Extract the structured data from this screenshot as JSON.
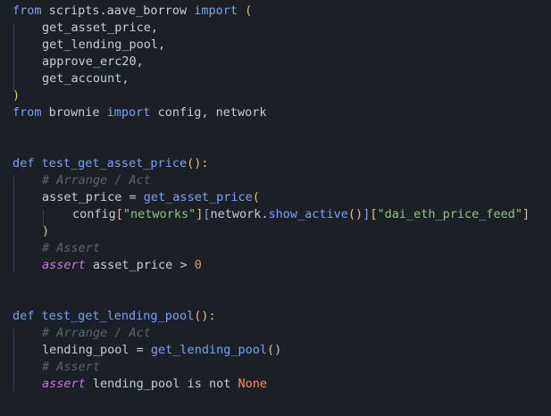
{
  "code": {
    "lines": [
      {
        "from1": "from",
        "mod1": " scripts.aave_borrow ",
        "imp1": "import",
        "open1": " ("
      },
      {
        "name": "get_asset_price,"
      },
      {
        "name": "get_lending_pool,"
      },
      {
        "name": "approve_erc20,"
      },
      {
        "name": "get_account,"
      },
      {
        "close": ")"
      },
      {
        "from2": "from",
        "mod2": " brownie ",
        "imp2": "import",
        "rest2": " config, network"
      },
      {},
      {},
      {
        "def": "def",
        "fname": " test_get_asset_price",
        "parens": "():",
        "colon": ""
      },
      {
        "comment": "# Arrange / Act"
      },
      {
        "lhs": "asset_price = ",
        "call": "get_asset_price",
        "paren": "("
      },
      {
        "cfg": "config",
        "b1o": "[",
        "s1": "\"networks\"",
        "b1c": "]",
        "b2o": "[",
        "net": "network.",
        "meth": "show_active",
        "mp": "()",
        "b2c": "]",
        "b3o": "[",
        "s2": "\"dai_eth_price_feed\"",
        "b3c": "]"
      },
      {
        "close": ")"
      },
      {
        "comment": "# Assert"
      },
      {
        "assert": "assert",
        "expr": " asset_price > ",
        "num": "0"
      },
      {},
      {},
      {
        "def": "def",
        "fname": " test_get_lending_pool",
        "parens": "():"
      },
      {
        "comment": "# Arrange / Act"
      },
      {
        "lhs": "lending_pool = ",
        "call": "get_lending_pool",
        "paren": "()"
      },
      {
        "comment": "# Assert"
      },
      {
        "assert": "assert",
        "expr": " lending_pool is not ",
        "none": "None"
      }
    ]
  },
  "colors": {
    "background": "#1c1f26",
    "keyword": "#7aa2f7",
    "function": "#7aa2f7",
    "paren": "#e5c07b",
    "string": "#98c379",
    "comment": "#5c6370",
    "assert": "#c678dd",
    "number": "#f78c6c"
  }
}
